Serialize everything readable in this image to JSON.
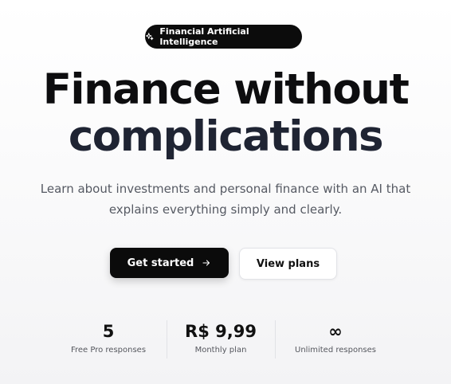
{
  "badge": {
    "icon": "sparkles-icon",
    "label": "Financial Artificial Intelligence"
  },
  "hero": {
    "title_line1": "Finance without",
    "title_line2": "complications",
    "subtitle": "Learn about investments and personal finance with an AI that explains everything simply and clearly."
  },
  "actions": {
    "primary_label": "Get started",
    "primary_icon": "arrow-right-icon",
    "secondary_label": "View plans"
  },
  "stats": [
    {
      "value": "5",
      "label": "Free Pro responses"
    },
    {
      "value": "R$ 9,99",
      "label": "Monthly plan"
    },
    {
      "value": "∞",
      "label": "Unlimited responses"
    }
  ],
  "colors": {
    "primary_button": "#0b0b0b",
    "title_line2": "#1f2433",
    "subtitle": "#565a63"
  }
}
